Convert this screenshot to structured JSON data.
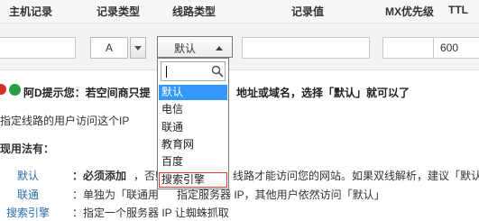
{
  "header": {
    "host_record": "主机记录",
    "record_type": "记录类型",
    "line_type": "线路类型",
    "record_value": "记录值",
    "mx_priority": "MX优先级",
    "ttl": "TTL"
  },
  "form": {
    "record_type_value": "A",
    "line_type_value": "默认",
    "ttl_value": "600"
  },
  "dropdown": {
    "search_value": "",
    "items": [
      "默认",
      "电信",
      "联通",
      "教育网",
      "百度",
      "搜索引擎"
    ],
    "selected_index": 0,
    "highlighted_index": 5
  },
  "notice": {
    "left": "阿D提示您：若空间商只提",
    "right": "地址或域名，选择「默认」就可以了"
  },
  "body": {
    "line1": "指定线路的用户访问这个IP",
    "line2": "现用法有：",
    "rows": [
      {
        "label": "默认",
        "text_a": "：必须添加",
        "text_b": "，否则",
        "text_c": "线路才能访问您的网站。如果双线解析，建议「默认」"
      },
      {
        "label": "联通",
        "text_a": "：单独为「联通用",
        "text_b": "指定服务器 IP，其他用户依然访问「默认」"
      },
      {
        "label": "搜索引擎",
        "text_a": "：指定一个服务器 IP 让蜘蛛抓取"
      }
    ]
  },
  "colors": {
    "selected_bg": "#3399ff",
    "highlight_border": "#e53935",
    "link": "#2a6db0",
    "notice_icon": "#2a9d4a"
  }
}
